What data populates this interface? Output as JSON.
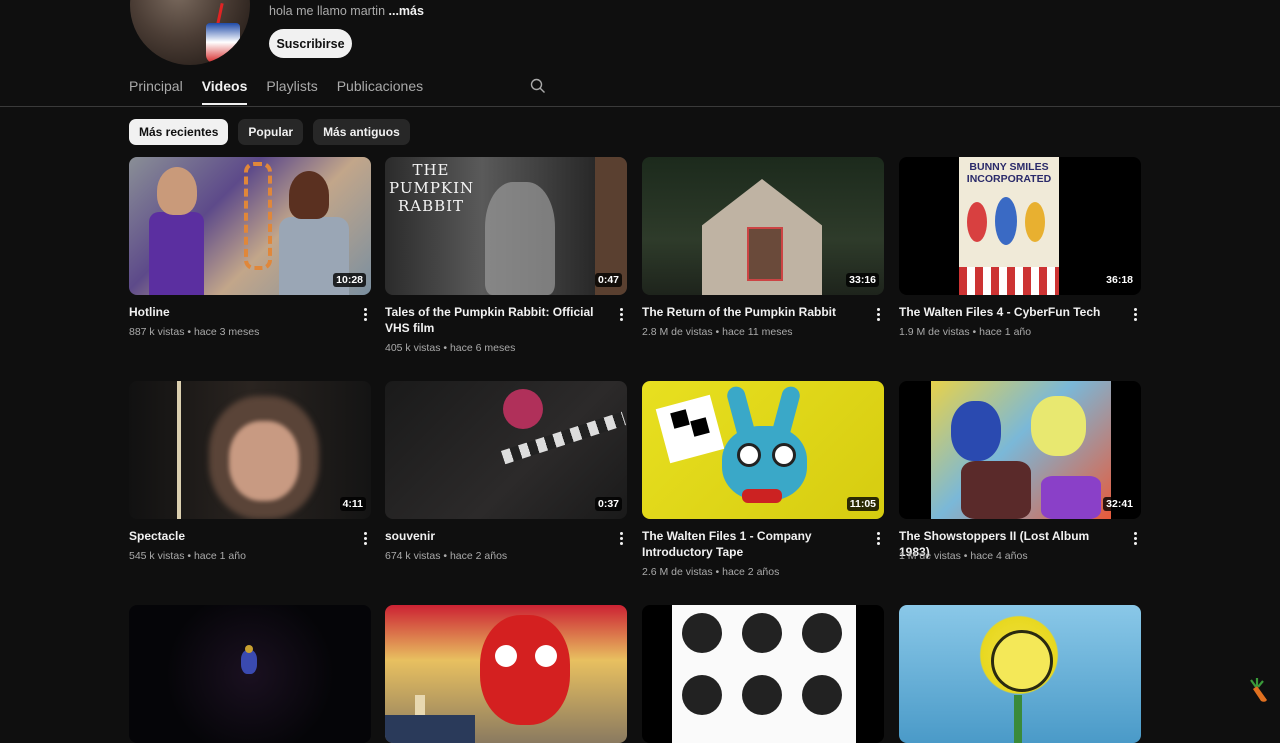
{
  "channel": {
    "description": "hola me llamo martin",
    "more_label": "...más",
    "subscribe_label": "Suscribirse"
  },
  "tabs": [
    {
      "label": "Principal",
      "active": false
    },
    {
      "label": "Videos",
      "active": true
    },
    {
      "label": "Playlists",
      "active": false
    },
    {
      "label": "Publicaciones",
      "active": false
    }
  ],
  "filters": [
    {
      "label": "Más recientes",
      "active": true
    },
    {
      "label": "Popular",
      "active": false
    },
    {
      "label": "Más antiguos",
      "active": false
    }
  ],
  "videos": [
    {
      "title": "Hotline",
      "duration": "10:28",
      "meta": "887 k vistas • hace 3 meses"
    },
    {
      "title": "Tales of the Pumpkin Rabbit: Official VHS film",
      "duration": "0:47",
      "meta": "405 k vistas • hace 6 meses",
      "thumb_text": "THE PUMPKIN RABBIT"
    },
    {
      "title": "The Return of the Pumpkin Rabbit",
      "duration": "33:16",
      "meta": "2.8 M de vistas • hace 11 meses"
    },
    {
      "title": "The Walten Files 4 - CyberFun Tech",
      "duration": "36:18",
      "meta": "1.9 M de vistas • hace 1 año",
      "thumb_text": "BUNNY SMILES INCORPORATED"
    },
    {
      "title": "Spectacle",
      "duration": "4:11",
      "meta": "545 k vistas • hace 1 año"
    },
    {
      "title": "souvenir",
      "duration": "0:37",
      "meta": "674 k vistas • hace 2 años"
    },
    {
      "title": "The Walten Files 1 - Company Introductory Tape",
      "duration": "11:05",
      "meta": "2.6 M de vistas • hace 2 años"
    },
    {
      "title": "The Showstoppers II (Lost Album 1983)",
      "duration": "32:41",
      "meta": "1 M de vistas • hace 4 años"
    },
    {
      "title": "",
      "duration": "",
      "meta": ""
    },
    {
      "title": "",
      "duration": "",
      "meta": ""
    },
    {
      "title": "",
      "duration": "",
      "meta": ""
    },
    {
      "title": "",
      "duration": "",
      "meta": ""
    }
  ],
  "colors": {
    "background": "#0f0f0f",
    "text": "#f1f1f1",
    "secondary_text": "#aaaaaa",
    "chip": "#272727"
  },
  "icons": {
    "tab_search": "search-icon",
    "more": "more-vert-icon",
    "corner": "carrot-icon"
  }
}
